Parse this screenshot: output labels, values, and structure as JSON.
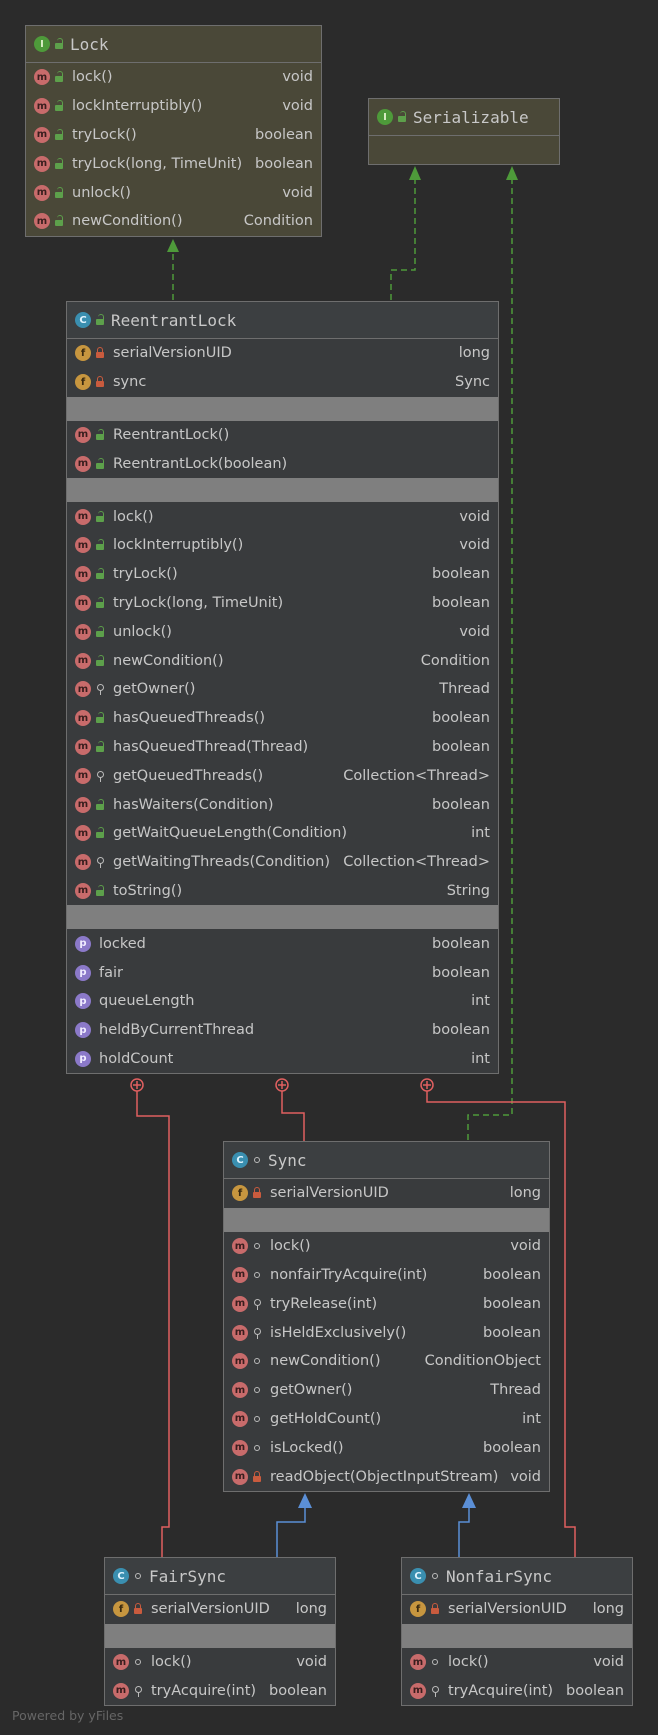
{
  "lock": {
    "title": "Lock",
    "methods": [
      {
        "name": "lock()",
        "type": "void"
      },
      {
        "name": "lockInterruptibly()",
        "type": "void"
      },
      {
        "name": "tryLock()",
        "type": "boolean"
      },
      {
        "name": "tryLock(long, TimeUnit)",
        "type": "boolean"
      },
      {
        "name": "unlock()",
        "type": "void"
      },
      {
        "name": "newCondition()",
        "type": "Condition"
      }
    ]
  },
  "serializable": {
    "title": "Serializable"
  },
  "reentrant": {
    "title": "ReentrantLock",
    "fields": [
      {
        "name": "serialVersionUID",
        "type": "long"
      },
      {
        "name": "sync",
        "type": "Sync"
      }
    ],
    "constructors": [
      {
        "name": "ReentrantLock()"
      },
      {
        "name": "ReentrantLock(boolean)"
      }
    ],
    "methods": [
      {
        "name": "lock()",
        "type": "void"
      },
      {
        "name": "lockInterruptibly()",
        "type": "void"
      },
      {
        "name": "tryLock()",
        "type": "boolean"
      },
      {
        "name": "tryLock(long, TimeUnit)",
        "type": "boolean"
      },
      {
        "name": "unlock()",
        "type": "void"
      },
      {
        "name": "newCondition()",
        "type": "Condition"
      },
      {
        "name": "getOwner()",
        "type": "Thread"
      },
      {
        "name": "hasQueuedThreads()",
        "type": "boolean"
      },
      {
        "name": "hasQueuedThread(Thread)",
        "type": "boolean"
      },
      {
        "name": "getQueuedThreads()",
        "type": "Collection<Thread>"
      },
      {
        "name": "hasWaiters(Condition)",
        "type": "boolean"
      },
      {
        "name": "getWaitQueueLength(Condition)",
        "type": "int"
      },
      {
        "name": "getWaitingThreads(Condition)",
        "type": "Collection<Thread>"
      },
      {
        "name": "toString()",
        "type": "String"
      }
    ],
    "properties": [
      {
        "name": "locked",
        "type": "boolean"
      },
      {
        "name": "fair",
        "type": "boolean"
      },
      {
        "name": "queueLength",
        "type": "int"
      },
      {
        "name": "heldByCurrentThread",
        "type": "boolean"
      },
      {
        "name": "holdCount",
        "type": "int"
      }
    ]
  },
  "sync": {
    "title": "Sync",
    "fields": [
      {
        "name": "serialVersionUID",
        "type": "long"
      }
    ],
    "methods": [
      {
        "name": "lock()",
        "type": "void"
      },
      {
        "name": "nonfairTryAcquire(int)",
        "type": "boolean"
      },
      {
        "name": "tryRelease(int)",
        "type": "boolean"
      },
      {
        "name": "isHeldExclusively()",
        "type": "boolean"
      },
      {
        "name": "newCondition()",
        "type": "ConditionObject"
      },
      {
        "name": "getOwner()",
        "type": "Thread"
      },
      {
        "name": "getHoldCount()",
        "type": "int"
      },
      {
        "name": "isLocked()",
        "type": "boolean"
      },
      {
        "name": "readObject(ObjectInputStream)",
        "type": "void"
      }
    ]
  },
  "fairsync": {
    "title": "FairSync",
    "fields": [
      {
        "name": "serialVersionUID",
        "type": "long"
      }
    ],
    "methods": [
      {
        "name": "lock()",
        "type": "void"
      },
      {
        "name": "tryAcquire(int)",
        "type": "boolean"
      }
    ]
  },
  "nonfairsync": {
    "title": "NonfairSync",
    "fields": [
      {
        "name": "serialVersionUID",
        "type": "long"
      }
    ],
    "methods": [
      {
        "name": "lock()",
        "type": "void"
      },
      {
        "name": "tryAcquire(int)",
        "type": "boolean"
      }
    ]
  },
  "badges": {
    "interface": "I",
    "class": "C",
    "method": "m",
    "field": "f",
    "property": "p"
  },
  "footer": "Powered by yFiles",
  "colors": {
    "realize": "#4e9a3a",
    "extend": "#5b8fd6",
    "inner": "#e06060"
  }
}
